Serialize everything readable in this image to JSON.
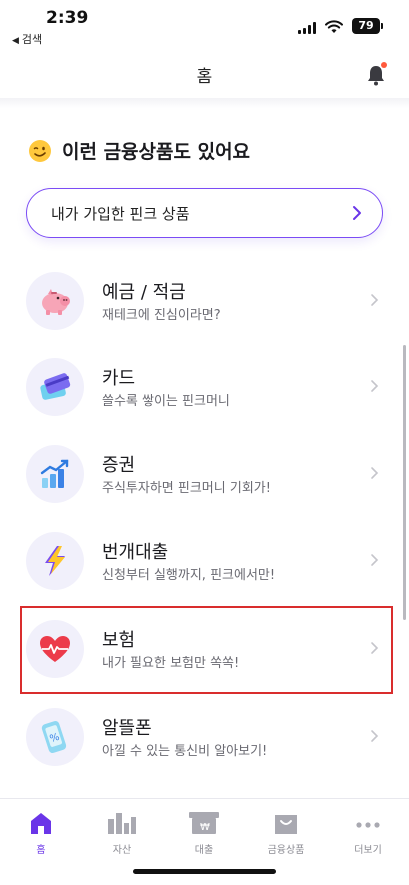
{
  "status_bar": {
    "time": "2:39",
    "back_app": "검색",
    "battery": "79"
  },
  "header": {
    "title": "홈"
  },
  "section": {
    "title": "이런 금융상품도 있어요"
  },
  "joined_products_button": {
    "label": "내가 가입한 핀크 상품"
  },
  "products": [
    {
      "icon": "piggy-bank-icon",
      "title": "예금 / 적금",
      "subtitle": "재테크에 진심이라면?"
    },
    {
      "icon": "card-icon",
      "title": "카드",
      "subtitle": "쓸수록 쌓이는 핀크머니"
    },
    {
      "icon": "stock-chart-icon",
      "title": "증권",
      "subtitle": "주식투자하면 핀크머니 기회가!"
    },
    {
      "icon": "lightning-icon",
      "title": "번개대출",
      "subtitle": "신청부터 실행까지, 핀크에서만!"
    },
    {
      "icon": "heart-pulse-icon",
      "title": "보험",
      "subtitle": "내가 필요한 보험만 쏙쏙!"
    },
    {
      "icon": "phone-icon",
      "title": "알뜰폰",
      "subtitle": "아낄 수 있는 통신비 알아보기!"
    }
  ],
  "tabs": [
    {
      "icon": "home-icon",
      "label": "홈",
      "active": true
    },
    {
      "icon": "bar-chart-icon",
      "label": "자산",
      "active": false
    },
    {
      "icon": "won-box-icon",
      "label": "대출",
      "active": false
    },
    {
      "icon": "shopping-bag-icon",
      "label": "금융상품",
      "active": false
    },
    {
      "icon": "more-icon",
      "label": "더보기",
      "active": false
    }
  ],
  "colors": {
    "accent": "#6a35e8",
    "highlight_border": "#d92d2d",
    "notification_dot": "#ff5a3c"
  }
}
